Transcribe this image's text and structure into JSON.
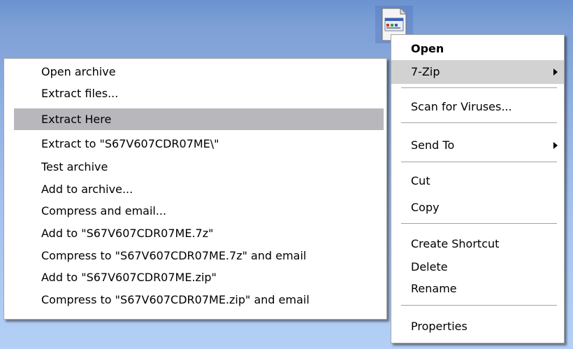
{
  "desktop_icon": {
    "name": "file-icon"
  },
  "context_menu": {
    "items": [
      {
        "label": "Open",
        "bold": true
      },
      {
        "label": "7-Zip",
        "highlighted": true,
        "submenu": true
      },
      {
        "label": "Scan for Viruses..."
      },
      {
        "label": "Send To",
        "submenu": true
      },
      {
        "label": "Cut"
      },
      {
        "label": "Copy"
      },
      {
        "label": "Create Shortcut"
      },
      {
        "label": "Delete"
      },
      {
        "label": "Rename"
      },
      {
        "label": "Properties"
      }
    ]
  },
  "sevenzip_submenu": {
    "items": [
      {
        "label": "Open archive"
      },
      {
        "label": "Extract files..."
      },
      {
        "label": "Extract Here",
        "highlighted": true
      },
      {
        "label": "Extract to \"S67V607CDR07ME\\\""
      },
      {
        "label": "Test archive"
      },
      {
        "label": "Add to archive..."
      },
      {
        "label": "Compress and email..."
      },
      {
        "label": "Add to \"S67V607CDR07ME.7z\""
      },
      {
        "label": "Compress to \"S67V607CDR07ME.7z\" and email"
      },
      {
        "label": "Add to \"S67V607CDR07ME.zip\""
      },
      {
        "label": "Compress to \"S67V607CDR07ME.zip\" and email"
      }
    ]
  },
  "colors": {
    "highlight": "#c0bebf",
    "menu_background": "#ffffff",
    "desktop_top": "#6c93cf",
    "desktop_bottom": "#b3cff5"
  }
}
